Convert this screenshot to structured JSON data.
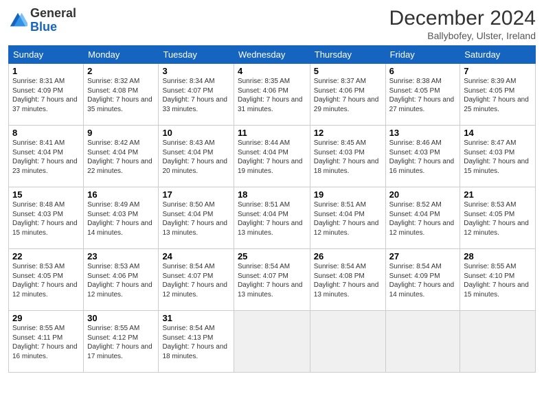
{
  "header": {
    "logo_general": "General",
    "logo_blue": "Blue",
    "month_title": "December 2024",
    "subtitle": "Ballybofey, Ulster, Ireland"
  },
  "days_of_week": [
    "Sunday",
    "Monday",
    "Tuesday",
    "Wednesday",
    "Thursday",
    "Friday",
    "Saturday"
  ],
  "weeks": [
    [
      {
        "day": "1",
        "sunrise": "Sunrise: 8:31 AM",
        "sunset": "Sunset: 4:09 PM",
        "daylight": "Daylight: 7 hours and 37 minutes."
      },
      {
        "day": "2",
        "sunrise": "Sunrise: 8:32 AM",
        "sunset": "Sunset: 4:08 PM",
        "daylight": "Daylight: 7 hours and 35 minutes."
      },
      {
        "day": "3",
        "sunrise": "Sunrise: 8:34 AM",
        "sunset": "Sunset: 4:07 PM",
        "daylight": "Daylight: 7 hours and 33 minutes."
      },
      {
        "day": "4",
        "sunrise": "Sunrise: 8:35 AM",
        "sunset": "Sunset: 4:06 PM",
        "daylight": "Daylight: 7 hours and 31 minutes."
      },
      {
        "day": "5",
        "sunrise": "Sunrise: 8:37 AM",
        "sunset": "Sunset: 4:06 PM",
        "daylight": "Daylight: 7 hours and 29 minutes."
      },
      {
        "day": "6",
        "sunrise": "Sunrise: 8:38 AM",
        "sunset": "Sunset: 4:05 PM",
        "daylight": "Daylight: 7 hours and 27 minutes."
      },
      {
        "day": "7",
        "sunrise": "Sunrise: 8:39 AM",
        "sunset": "Sunset: 4:05 PM",
        "daylight": "Daylight: 7 hours and 25 minutes."
      }
    ],
    [
      {
        "day": "8",
        "sunrise": "Sunrise: 8:41 AM",
        "sunset": "Sunset: 4:04 PM",
        "daylight": "Daylight: 7 hours and 23 minutes."
      },
      {
        "day": "9",
        "sunrise": "Sunrise: 8:42 AM",
        "sunset": "Sunset: 4:04 PM",
        "daylight": "Daylight: 7 hours and 22 minutes."
      },
      {
        "day": "10",
        "sunrise": "Sunrise: 8:43 AM",
        "sunset": "Sunset: 4:04 PM",
        "daylight": "Daylight: 7 hours and 20 minutes."
      },
      {
        "day": "11",
        "sunrise": "Sunrise: 8:44 AM",
        "sunset": "Sunset: 4:04 PM",
        "daylight": "Daylight: 7 hours and 19 minutes."
      },
      {
        "day": "12",
        "sunrise": "Sunrise: 8:45 AM",
        "sunset": "Sunset: 4:03 PM",
        "daylight": "Daylight: 7 hours and 18 minutes."
      },
      {
        "day": "13",
        "sunrise": "Sunrise: 8:46 AM",
        "sunset": "Sunset: 4:03 PM",
        "daylight": "Daylight: 7 hours and 16 minutes."
      },
      {
        "day": "14",
        "sunrise": "Sunrise: 8:47 AM",
        "sunset": "Sunset: 4:03 PM",
        "daylight": "Daylight: 7 hours and 15 minutes."
      }
    ],
    [
      {
        "day": "15",
        "sunrise": "Sunrise: 8:48 AM",
        "sunset": "Sunset: 4:03 PM",
        "daylight": "Daylight: 7 hours and 15 minutes."
      },
      {
        "day": "16",
        "sunrise": "Sunrise: 8:49 AM",
        "sunset": "Sunset: 4:03 PM",
        "daylight": "Daylight: 7 hours and 14 minutes."
      },
      {
        "day": "17",
        "sunrise": "Sunrise: 8:50 AM",
        "sunset": "Sunset: 4:04 PM",
        "daylight": "Daylight: 7 hours and 13 minutes."
      },
      {
        "day": "18",
        "sunrise": "Sunrise: 8:51 AM",
        "sunset": "Sunset: 4:04 PM",
        "daylight": "Daylight: 7 hours and 13 minutes."
      },
      {
        "day": "19",
        "sunrise": "Sunrise: 8:51 AM",
        "sunset": "Sunset: 4:04 PM",
        "daylight": "Daylight: 7 hours and 12 minutes."
      },
      {
        "day": "20",
        "sunrise": "Sunrise: 8:52 AM",
        "sunset": "Sunset: 4:04 PM",
        "daylight": "Daylight: 7 hours and 12 minutes."
      },
      {
        "day": "21",
        "sunrise": "Sunrise: 8:53 AM",
        "sunset": "Sunset: 4:05 PM",
        "daylight": "Daylight: 7 hours and 12 minutes."
      }
    ],
    [
      {
        "day": "22",
        "sunrise": "Sunrise: 8:53 AM",
        "sunset": "Sunset: 4:05 PM",
        "daylight": "Daylight: 7 hours and 12 minutes."
      },
      {
        "day": "23",
        "sunrise": "Sunrise: 8:53 AM",
        "sunset": "Sunset: 4:06 PM",
        "daylight": "Daylight: 7 hours and 12 minutes."
      },
      {
        "day": "24",
        "sunrise": "Sunrise: 8:54 AM",
        "sunset": "Sunset: 4:07 PM",
        "daylight": "Daylight: 7 hours and 12 minutes."
      },
      {
        "day": "25",
        "sunrise": "Sunrise: 8:54 AM",
        "sunset": "Sunset: 4:07 PM",
        "daylight": "Daylight: 7 hours and 13 minutes."
      },
      {
        "day": "26",
        "sunrise": "Sunrise: 8:54 AM",
        "sunset": "Sunset: 4:08 PM",
        "daylight": "Daylight: 7 hours and 13 minutes."
      },
      {
        "day": "27",
        "sunrise": "Sunrise: 8:54 AM",
        "sunset": "Sunset: 4:09 PM",
        "daylight": "Daylight: 7 hours and 14 minutes."
      },
      {
        "day": "28",
        "sunrise": "Sunrise: 8:55 AM",
        "sunset": "Sunset: 4:10 PM",
        "daylight": "Daylight: 7 hours and 15 minutes."
      }
    ],
    [
      {
        "day": "29",
        "sunrise": "Sunrise: 8:55 AM",
        "sunset": "Sunset: 4:11 PM",
        "daylight": "Daylight: 7 hours and 16 minutes."
      },
      {
        "day": "30",
        "sunrise": "Sunrise: 8:55 AM",
        "sunset": "Sunset: 4:12 PM",
        "daylight": "Daylight: 7 hours and 17 minutes."
      },
      {
        "day": "31",
        "sunrise": "Sunrise: 8:54 AM",
        "sunset": "Sunset: 4:13 PM",
        "daylight": "Daylight: 7 hours and 18 minutes."
      },
      null,
      null,
      null,
      null
    ]
  ]
}
